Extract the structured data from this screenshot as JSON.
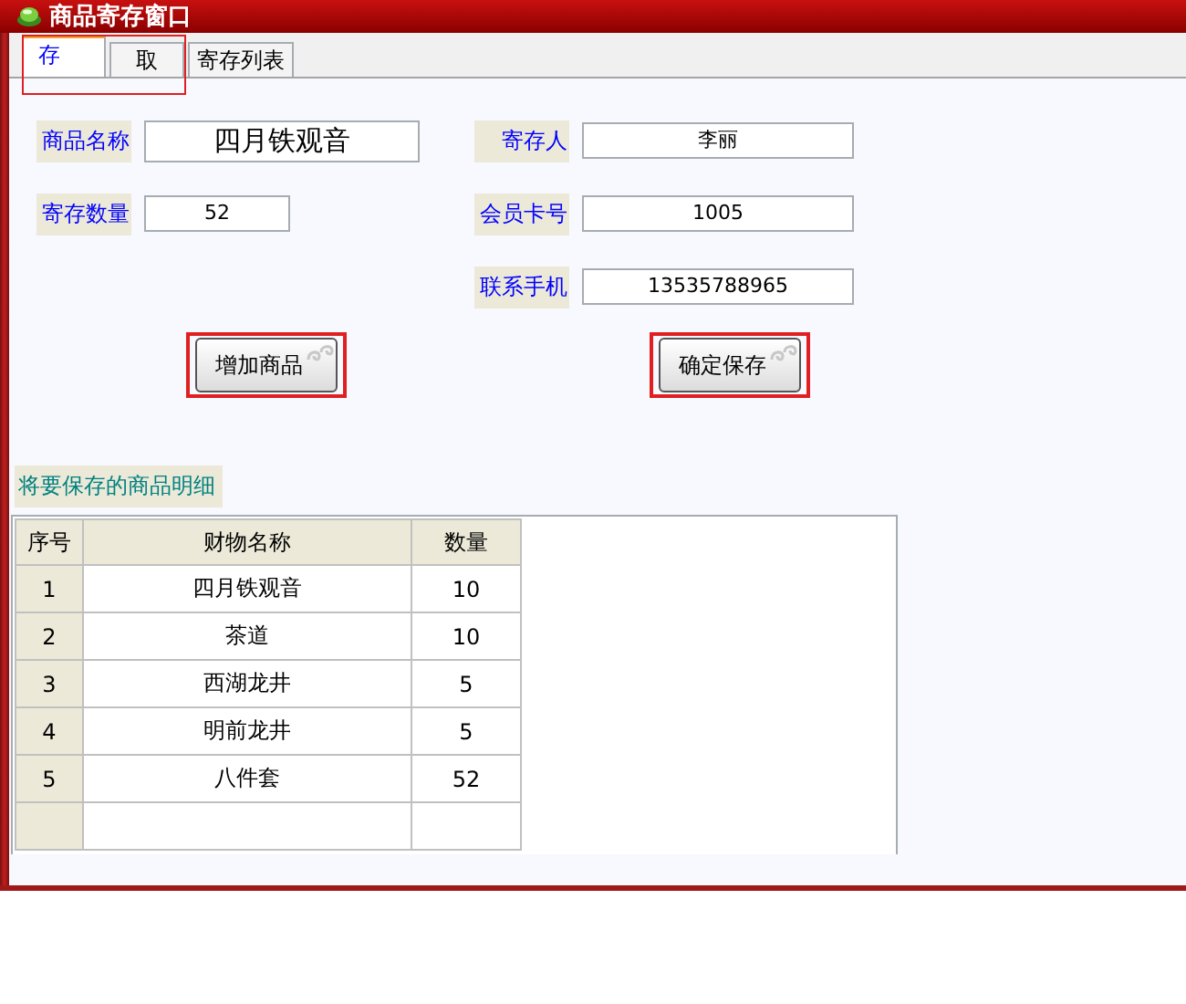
{
  "window": {
    "title": "商品寄存窗口"
  },
  "tabs": [
    {
      "label": "存",
      "selected": true
    },
    {
      "label": "取",
      "selected": false
    },
    {
      "label": "寄存列表",
      "selected": false
    }
  ],
  "form": {
    "left": [
      {
        "label": "商品名称",
        "value": "四月铁观音",
        "kind": "wide"
      },
      {
        "label": "寄存数量",
        "value": "52",
        "kind": "narrow"
      }
    ],
    "right": [
      {
        "label": "寄存人",
        "value": "李丽"
      },
      {
        "label": "会员卡号",
        "value": "1005"
      },
      {
        "label": "联系手机",
        "value": "13535788965"
      }
    ]
  },
  "buttons": [
    {
      "label": "增加商品"
    },
    {
      "label": "确定保存"
    }
  ],
  "detail": {
    "title": "将要保存的商品明细",
    "columns": [
      "序号",
      "财物名称",
      "数量"
    ],
    "rows": [
      [
        "1",
        "四月铁观音",
        "10"
      ],
      [
        "2",
        "茶道",
        "10"
      ],
      [
        "3",
        "西湖龙井",
        "5"
      ],
      [
        "4",
        "明前龙井",
        "5"
      ],
      [
        "5",
        "八件套",
        "52"
      ]
    ]
  }
}
